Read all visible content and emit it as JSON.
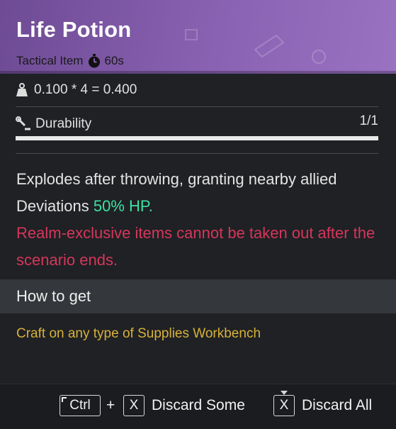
{
  "item": {
    "name": "Life Potion",
    "category": "Tactical Item",
    "cooldown": "60s"
  },
  "weight": {
    "formula": "0.100 * 4 = 0.400"
  },
  "durability": {
    "label": "Durability",
    "value": "1/1",
    "fraction": 1.0
  },
  "description": {
    "line_main": "Explodes after throwing, granting nearby allied Deviations ",
    "highlight": "50% HP.",
    "warning": "Realm-exclusive items cannot be taken out after the scenario ends."
  },
  "how_to_get": {
    "title": "How to get",
    "source": "Craft on any type of Supplies Workbench"
  },
  "footer": {
    "key_ctrl": "Ctrl",
    "plus": "+",
    "key_x": "X",
    "discard_some": "Discard Some",
    "discard_all": "Discard All"
  },
  "colors": {
    "header_purple": "#8a62b3",
    "highlight_green": "#3fe0a2",
    "warning_red": "#d6365c",
    "source_gold": "#d7b13a"
  },
  "icons": [
    "stopwatch-icon",
    "weight-icon",
    "wrench-icon"
  ]
}
